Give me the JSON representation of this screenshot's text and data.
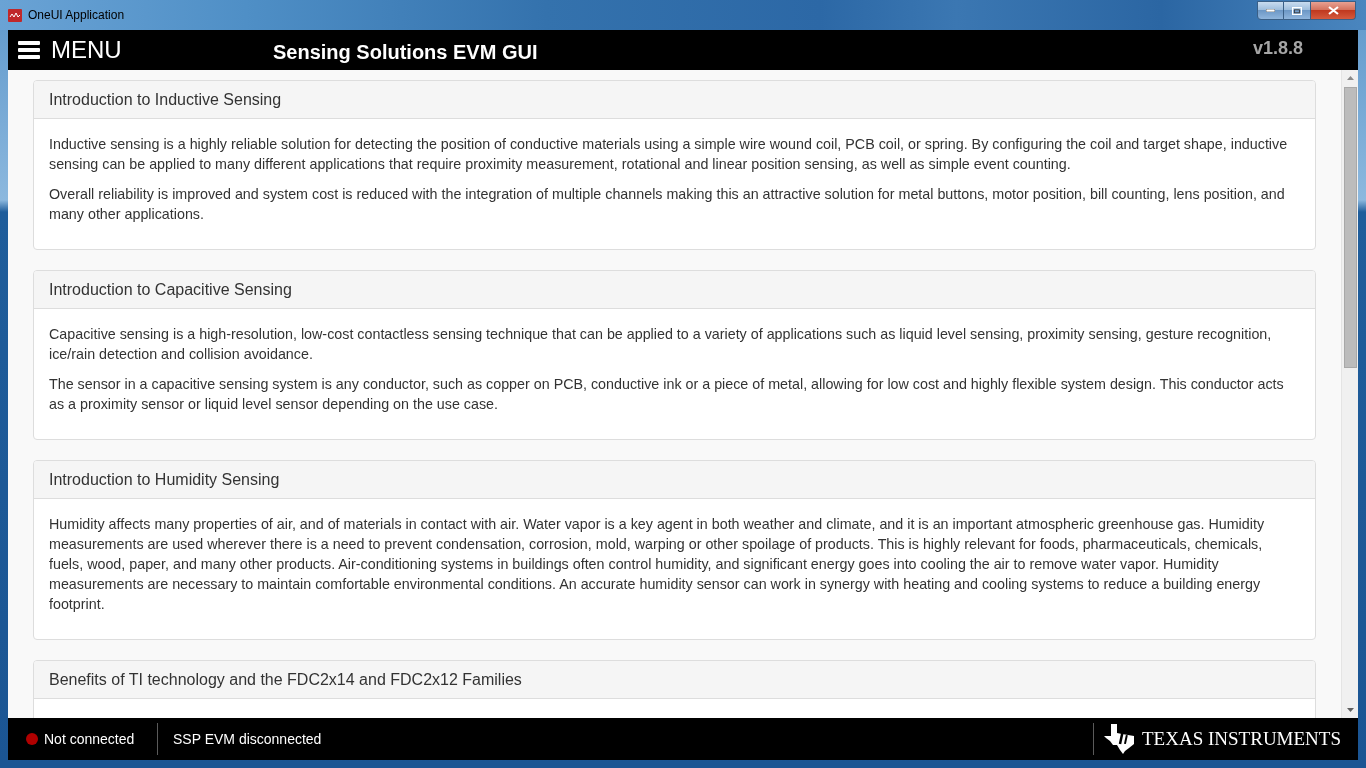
{
  "window": {
    "title": "OneUI Application"
  },
  "header": {
    "menu_label": "MENU",
    "title": "Sensing Solutions EVM GUI",
    "version": "v1.8.8"
  },
  "sections": [
    {
      "title": "Introduction to Inductive Sensing",
      "paragraphs": [
        "Inductive sensing is a highly reliable solution for detecting the position of conductive materials using a simple wire wound coil, PCB coil, or spring. By configuring the coil and target shape, inductive sensing can be applied to many different applications that require proximity measurement, rotational and linear position sensing, as well as simple event counting.",
        "Overall reliability is improved and system cost is reduced with the integration of multiple channels making this an attractive solution for metal buttons, motor position, bill counting, lens position, and many other applications."
      ]
    },
    {
      "title": "Introduction to Capacitive Sensing",
      "paragraphs": [
        "Capacitive sensing is a high-resolution, low-cost contactless sensing technique that can be applied to a variety of applications such as liquid level sensing, proximity sensing, gesture recognition, ice/rain detection and collision avoidance.",
        "The sensor in a capacitive sensing system is any conductor, such as copper on PCB, conductive ink or a piece of metal, allowing for low cost and highly flexible system design. This conductor acts as a proximity sensor or liquid level sensor depending on the use case."
      ]
    },
    {
      "title": "Introduction to Humidity Sensing",
      "paragraphs": [
        "Humidity affects many properties of air, and of materials in contact with air. Water vapor is a key agent in both weather and climate, and it is an important atmospheric greenhouse gas. Humidity measurements are used wherever there is a need to prevent condensation, corrosion, mold, warping or other spoilage of products. This is highly relevant for foods, pharmaceuticals, chemicals, fuels, wood, paper, and many other products. Air-conditioning systems in buildings often control humidity, and significant energy goes into cooling the air to remove water vapor. Humidity measurements are necessary to maintain comfortable environmental conditions. An accurate humidity sensor can work in synergy with heating and cooling systems to reduce a building energy footprint."
      ]
    },
    {
      "title": "Benefits of TI technology and the FDC2x14 and FDC2x12 Families"
    }
  ],
  "status_bar": {
    "connected": false,
    "connection_label": "Not connected",
    "device_status": "SSP EVM disconnected",
    "brand": "TEXAS INSTRUMENTS"
  }
}
